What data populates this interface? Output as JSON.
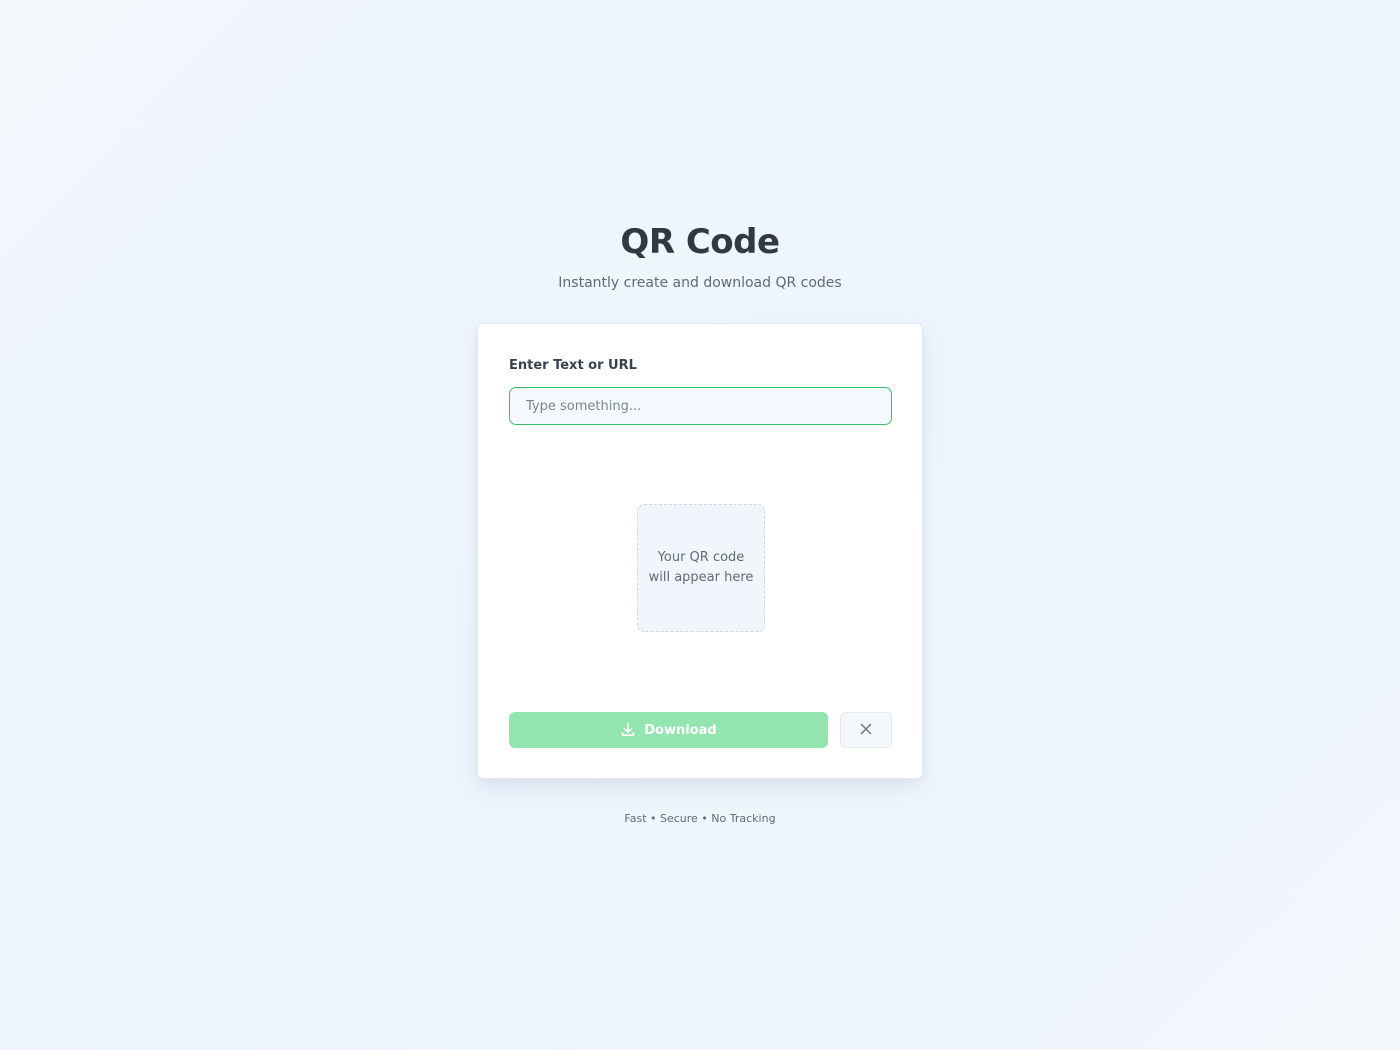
{
  "header": {
    "title": "QR Code",
    "subtitle": "Instantly create and download QR codes"
  },
  "form": {
    "label": "Enter Text or URL",
    "input_value": "",
    "input_placeholder": "Type something..."
  },
  "preview": {
    "placeholder_text": "Your QR code will appear here"
  },
  "actions": {
    "download_label": "Download",
    "download_icon": "download-icon",
    "clear_icon": "close-icon"
  },
  "footer": {
    "text": "Fast • Secure • No Tracking"
  },
  "colors": {
    "accent": "#3cbf67",
    "button_disabled": "#92e5ae",
    "background": "#eef5fd"
  }
}
